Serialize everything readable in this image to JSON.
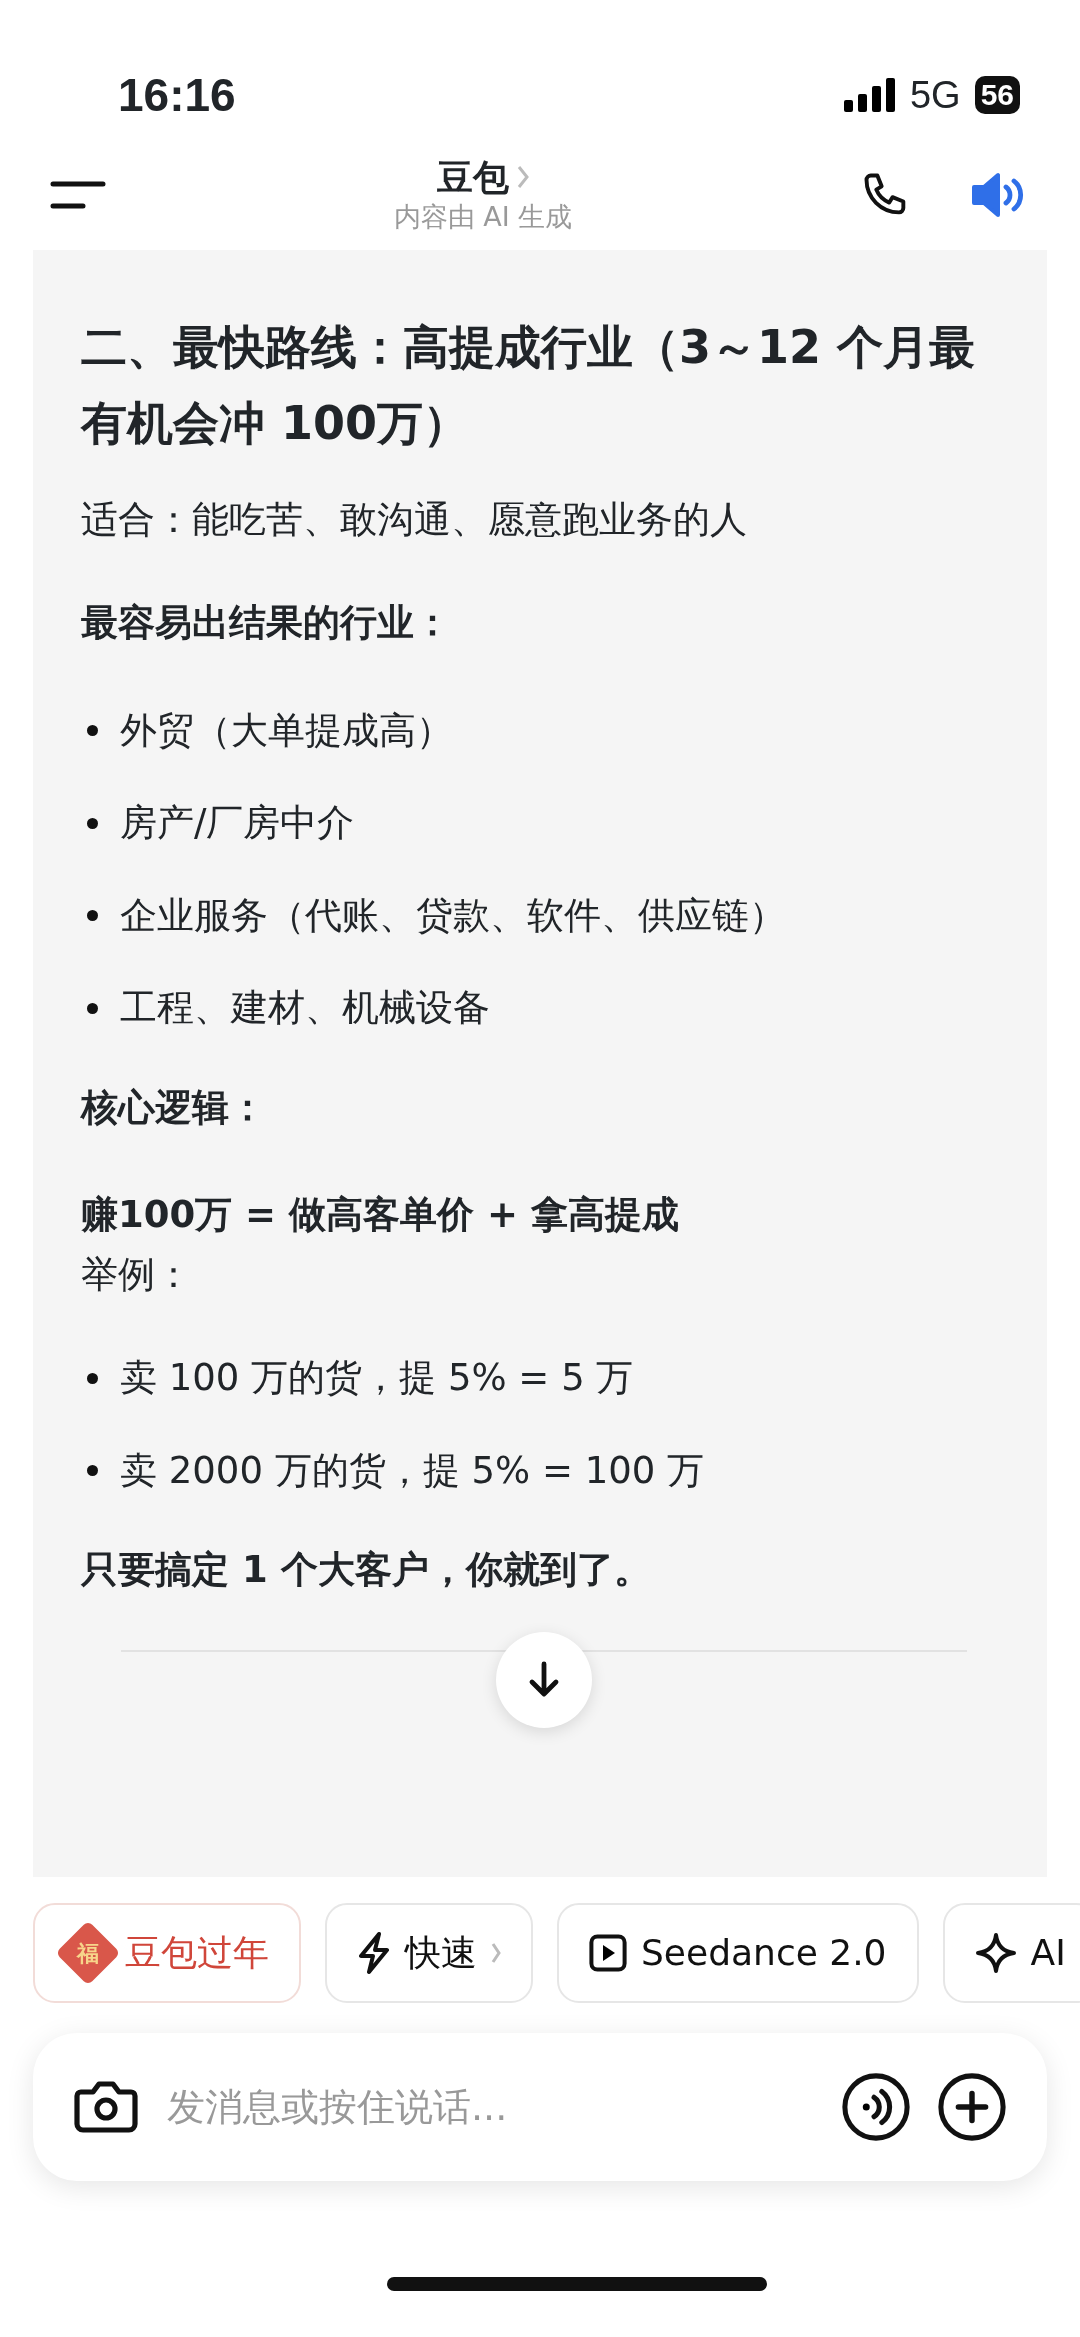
{
  "status_bar": {
    "time": "16:16",
    "network": "5G",
    "battery": "56"
  },
  "header": {
    "title": "豆包",
    "subtitle": "内容由 AI 生成"
  },
  "content": [
    {
      "kind": "heading",
      "text": "二、最快路线：高提成行业（3～12 个月最有机会冲 100万）"
    },
    {
      "kind": "para",
      "text": "适合：能吃苦、敢沟通、愿意跑业务的人"
    },
    {
      "kind": "label",
      "text": "最容易出结果的行业："
    },
    {
      "kind": "bullets",
      "items": [
        "外贸（大单提成高）",
        "房产/厂房中介",
        "企业服务（代账、贷款、软件、供应链）",
        "工程、建材、机械设备"
      ]
    },
    {
      "kind": "label",
      "text": "核心逻辑："
    },
    {
      "kind": "label",
      "text": "赚100万 = 做高客单价 + 拿高提成"
    },
    {
      "kind": "para",
      "text": "举例："
    },
    {
      "kind": "bullets",
      "items": [
        "卖 100 万的货，提 5% = 5 万",
        "卖 2000 万的货，提 5% = 100 万"
      ]
    },
    {
      "kind": "label",
      "text": "只要搞定 1 个大客户，你就到了。"
    }
  ],
  "chips": [
    {
      "kind": "festival",
      "label": "豆包过年",
      "glyph": "福"
    },
    {
      "kind": "fast",
      "label": "快速"
    },
    {
      "kind": "video",
      "label": "Seedance 2.0"
    },
    {
      "kind": "ai",
      "label": "AI"
    }
  ],
  "composer": {
    "placeholder": "发消息或按住说话..."
  }
}
